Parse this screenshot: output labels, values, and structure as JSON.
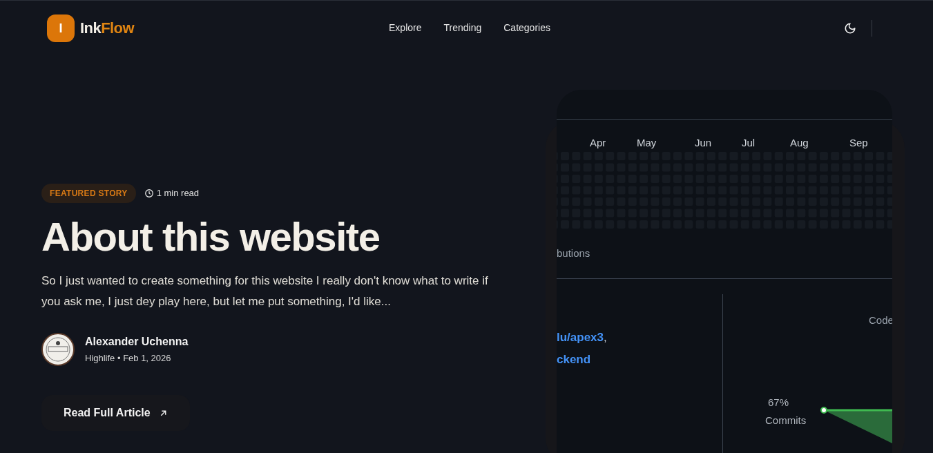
{
  "header": {
    "logo_letter": "I",
    "logo_word_1": "Ink",
    "logo_word_2": "Flow",
    "nav": [
      {
        "label": "Explore"
      },
      {
        "label": "Trending"
      },
      {
        "label": "Categories"
      }
    ]
  },
  "hero": {
    "badge": "FEATURED STORY",
    "read_time": "1 min read",
    "title": "About this website",
    "excerpt": "So I just wanted to create something for this website I really don't know what to write if you ask me, I just dey play here, but let me put something, I'd like...",
    "author": {
      "name": "Alexander Uchenna",
      "meta": "Highlife • Feb 1, 2026"
    },
    "cta": "Read Full Article"
  },
  "preview": {
    "months": [
      "Apr",
      "May",
      "Jun",
      "Jul",
      "Aug",
      "Sep"
    ],
    "contributions_label": "butions",
    "repo_lines": [
      {
        "text": "lu/apex3",
        "suffix": ","
      },
      {
        "text": "ckend"
      }
    ],
    "code_label": "Code",
    "stat_percent": "67%",
    "stat_label": "Commits"
  }
}
